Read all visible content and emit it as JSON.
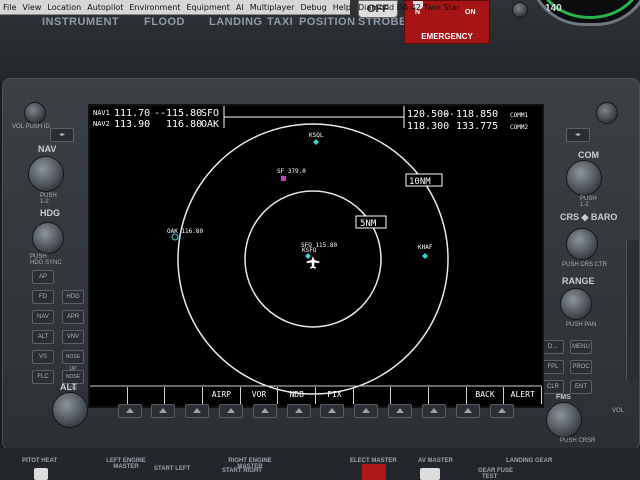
{
  "menubar": {
    "items": [
      "File",
      "View",
      "Location",
      "Autopilot",
      "Environment",
      "Equipment",
      "AI",
      "Multiplayer",
      "Debug",
      "Help"
    ],
    "aircraft_title": "Diamond DA 42 Twin Star"
  },
  "top_panel": {
    "switch_labels": [
      "INSTRUMENT",
      "FLOOD",
      "LANDING",
      "TAXI",
      "POSITION",
      "STROBE"
    ],
    "off_label": "OFF",
    "emergency": {
      "on_label": "ON",
      "n_label": "N",
      "label": "EMERGENCY"
    },
    "gauge_tick": "140"
  },
  "mfd": {
    "nav1": {
      "label": "NAV1",
      "active": "111.70",
      "standby": "115.80",
      "ident": "SFO"
    },
    "nav2": {
      "label": "NAV2",
      "active": "113.90",
      "standby": "116.80",
      "ident": "OAK"
    },
    "com1": {
      "active": "120.500",
      "standby": "118.850",
      "label": "COMM1"
    },
    "com2": {
      "active": "118.300",
      "standby": "133.775",
      "label": "COMM2"
    },
    "range_rings": [
      "10NM",
      "5NM"
    ],
    "map_labels": {
      "ksql": "KSQL",
      "sf": "SF 379.0",
      "oak": "OAK 116.80",
      "sfo": "SFO 115.80",
      "ksfo": "KSFO",
      "khaf": "KHAF"
    },
    "softkeys": [
      "",
      "",
      "",
      "AIRP",
      "VOR",
      "NDB",
      "FIX",
      "",
      "",
      "",
      "BACK",
      "ALERT"
    ]
  },
  "left_controls": {
    "nav": "NAV",
    "push_12": "PUSH\n1-2",
    "hdg": "HDG",
    "push_hdg_sync": "PUSH\nHDG SYNC",
    "ap_buttons": [
      "AP",
      "FD",
      "HDG",
      "NAV",
      "APR",
      "ALT",
      "VNV",
      "VS",
      "NOSE UP",
      "FLC",
      "NOSE DN"
    ],
    "alt": "ALT",
    "vol_id": "VOL PUSH ID"
  },
  "right_controls": {
    "com": "COM",
    "push_12": "PUSH\n1-2",
    "crs_baro": "CRS ◆ BARO",
    "push_crs_ctr": "PUSH CRS CTR",
    "range": "RANGE",
    "push_pan": "PUSH PAN",
    "buttons": [
      "D→",
      "MENU",
      "FPL",
      "PROC",
      "CLR",
      "ENT"
    ],
    "fms": "FMS",
    "push_crsr": "PUSH CRSR",
    "vol": "VOL"
  },
  "bottom_panel": {
    "labels": [
      "PITOT HEAT",
      "LEFT ENGINE MASTER",
      "START LEFT",
      "RIGHT ENGINE MASTER",
      "START RIGHT",
      "ELECT MASTER",
      "AV MASTER",
      "LANDING GEAR",
      "GEAR FUSE",
      "TEST"
    ]
  }
}
